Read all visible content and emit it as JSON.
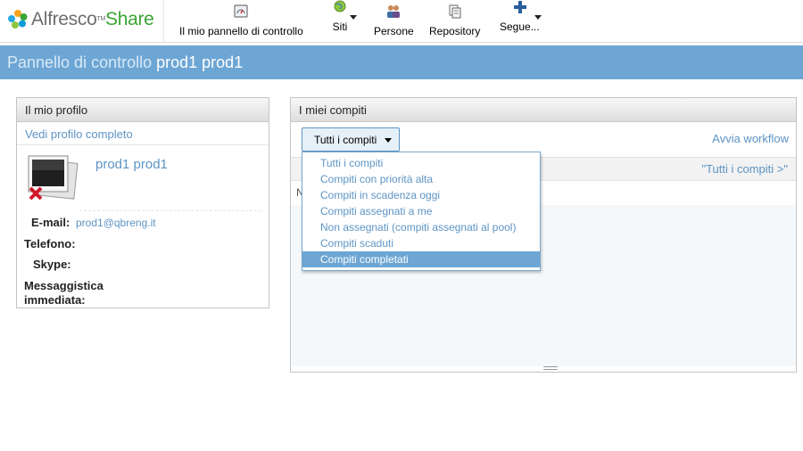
{
  "header": {
    "logo_primary": "Alfresco",
    "logo_tm": "TM",
    "logo_secondary": "Share",
    "nav": [
      {
        "label": "Il mio pannello di controllo",
        "icon": "dashboard-icon"
      },
      {
        "label": "Siti",
        "icon": "globe-icon"
      },
      {
        "label": "Persone",
        "icon": "people-icon"
      },
      {
        "label": "Repository",
        "icon": "repository-icon"
      },
      {
        "label": "Segue...",
        "icon": "plus-icon"
      }
    ]
  },
  "titlebar": {
    "prefix": "Pannello di controllo",
    "user": "prod1 prod1"
  },
  "profile": {
    "title": "Il mio profilo",
    "view_full": "Vedi profilo completo",
    "name": "prod1 prod1",
    "email_label": "E-mail:",
    "email_value": "prod1@qbreng.it",
    "phone_label": "Telefono:",
    "skype_label": "Skype:",
    "im_label_1": "Messaggistica",
    "im_label_2": "immediata:"
  },
  "tasks": {
    "title": "I miei compiti",
    "filter_label": "Tutti i compiti",
    "start_workflow": "Avvia workflow",
    "all_tasks": "\"Tutti i compiti >\"",
    "nothing": "N",
    "menu": [
      "Tutti i compiti",
      "Compiti con priorità alta",
      "Compiti in scadenza oggi",
      "Compiti assegnati a me",
      "Non assegnati (compiti assegnati al pool)",
      "Compiti scaduti",
      "Compiti completati"
    ],
    "menu_selected_index": 6
  },
  "colors": {
    "accent": "#6da6d4",
    "link": "#5d94c4",
    "brand_green": "#3aa434"
  }
}
